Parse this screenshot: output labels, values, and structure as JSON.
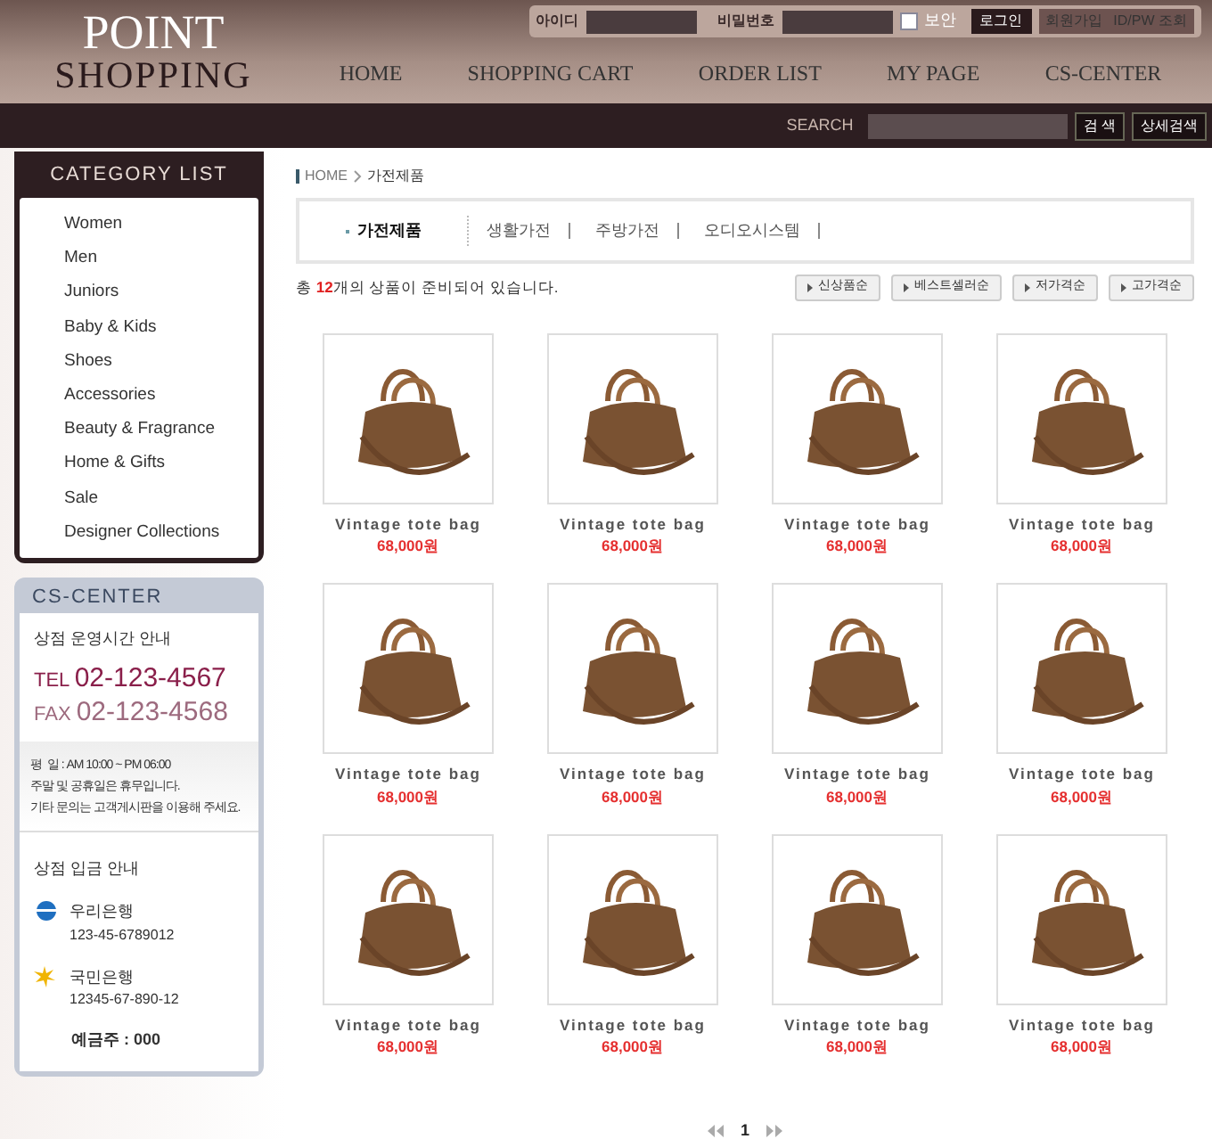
{
  "header": {
    "logo": [
      "POINT",
      "SHOPPING"
    ],
    "login": {
      "id_label": "아이디",
      "pw_label": "비밀번호",
      "secure": {
        "label": "보안",
        "checked": false
      },
      "login_button": "로그인",
      "links": [
        "회원가입",
        "ID/PW 조회"
      ]
    },
    "nav": [
      "HOME",
      "SHOPPING CART",
      "ORDER LIST",
      "MY PAGE",
      "CS-CENTER"
    ]
  },
  "search": {
    "label": "SEARCH",
    "buttons": [
      "검 색",
      "상세검색"
    ]
  },
  "sidebar": {
    "category_title": "CATEGORY LIST",
    "categories": [
      "Women",
      "Men",
      "Juniors",
      "Baby & Kids",
      "Shoes",
      "Accessories",
      "Beauty & Fragrance",
      "Home & Gifts",
      "Sale",
      "Designer Collections"
    ],
    "cs_center": {
      "title": "CS-CENTER",
      "hours_title": "상점 운영시간 안내",
      "tel_label": "TEL",
      "tel": "02-123-4567",
      "fax_label": "FAX",
      "fax": "02-123-4568",
      "notes": [
        "평  일 : AM 10:00 ~ PM 06:00",
        "주말 및 공휴일은 휴무입니다.",
        "기타 문의는 고객게시판을 이용해 주세요."
      ],
      "deposit_title": "상점 입금 안내",
      "banks": [
        {
          "name": "우리은행",
          "account": "123-45-6789012",
          "color": "#1f6fc0"
        },
        {
          "name": "국민은행",
          "account": "12345-67-890-12",
          "color": "#f0b400"
        }
      ],
      "holder": "예금주 : 000"
    }
  },
  "breadcrumb": [
    "HOME",
    "가전제품"
  ],
  "category_tabs": [
    {
      "label": "가전제품",
      "selected": true
    },
    {
      "label": "생활가전",
      "selected": false
    },
    {
      "label": "주방가전",
      "selected": false
    },
    {
      "label": "오디오시스템",
      "selected": false
    }
  ],
  "summary": "총 **12**개의 상품이 준비되어 있습니다.",
  "sort_buttons": [
    "신상품순",
    "베스트셀러순",
    "저가격순",
    "고가격순"
  ],
  "products": [
    {
      "name": "Vintage tote bag",
      "price": "68,000원"
    },
    {
      "name": "Vintage tote bag",
      "price": "68,000원"
    },
    {
      "name": "Vintage tote bag",
      "price": "68,000원"
    },
    {
      "name": "Vintage tote bag",
      "price": "68,000원"
    },
    {
      "name": "Vintage tote bag",
      "price": "68,000원"
    },
    {
      "name": "Vintage tote bag",
      "price": "68,000원"
    },
    {
      "name": "Vintage tote bag",
      "price": "68,000원"
    },
    {
      "name": "Vintage tote bag",
      "price": "68,000원"
    },
    {
      "name": "Vintage tote bag",
      "price": "68,000원"
    },
    {
      "name": "Vintage tote bag",
      "price": "68,000원"
    },
    {
      "name": "Vintage tote bag",
      "price": "68,000원"
    },
    {
      "name": "Vintage tote bag",
      "price": "68,000원"
    }
  ],
  "pagination": {
    "pages": [
      {
        "label": "1",
        "selected": true
      }
    ]
  }
}
